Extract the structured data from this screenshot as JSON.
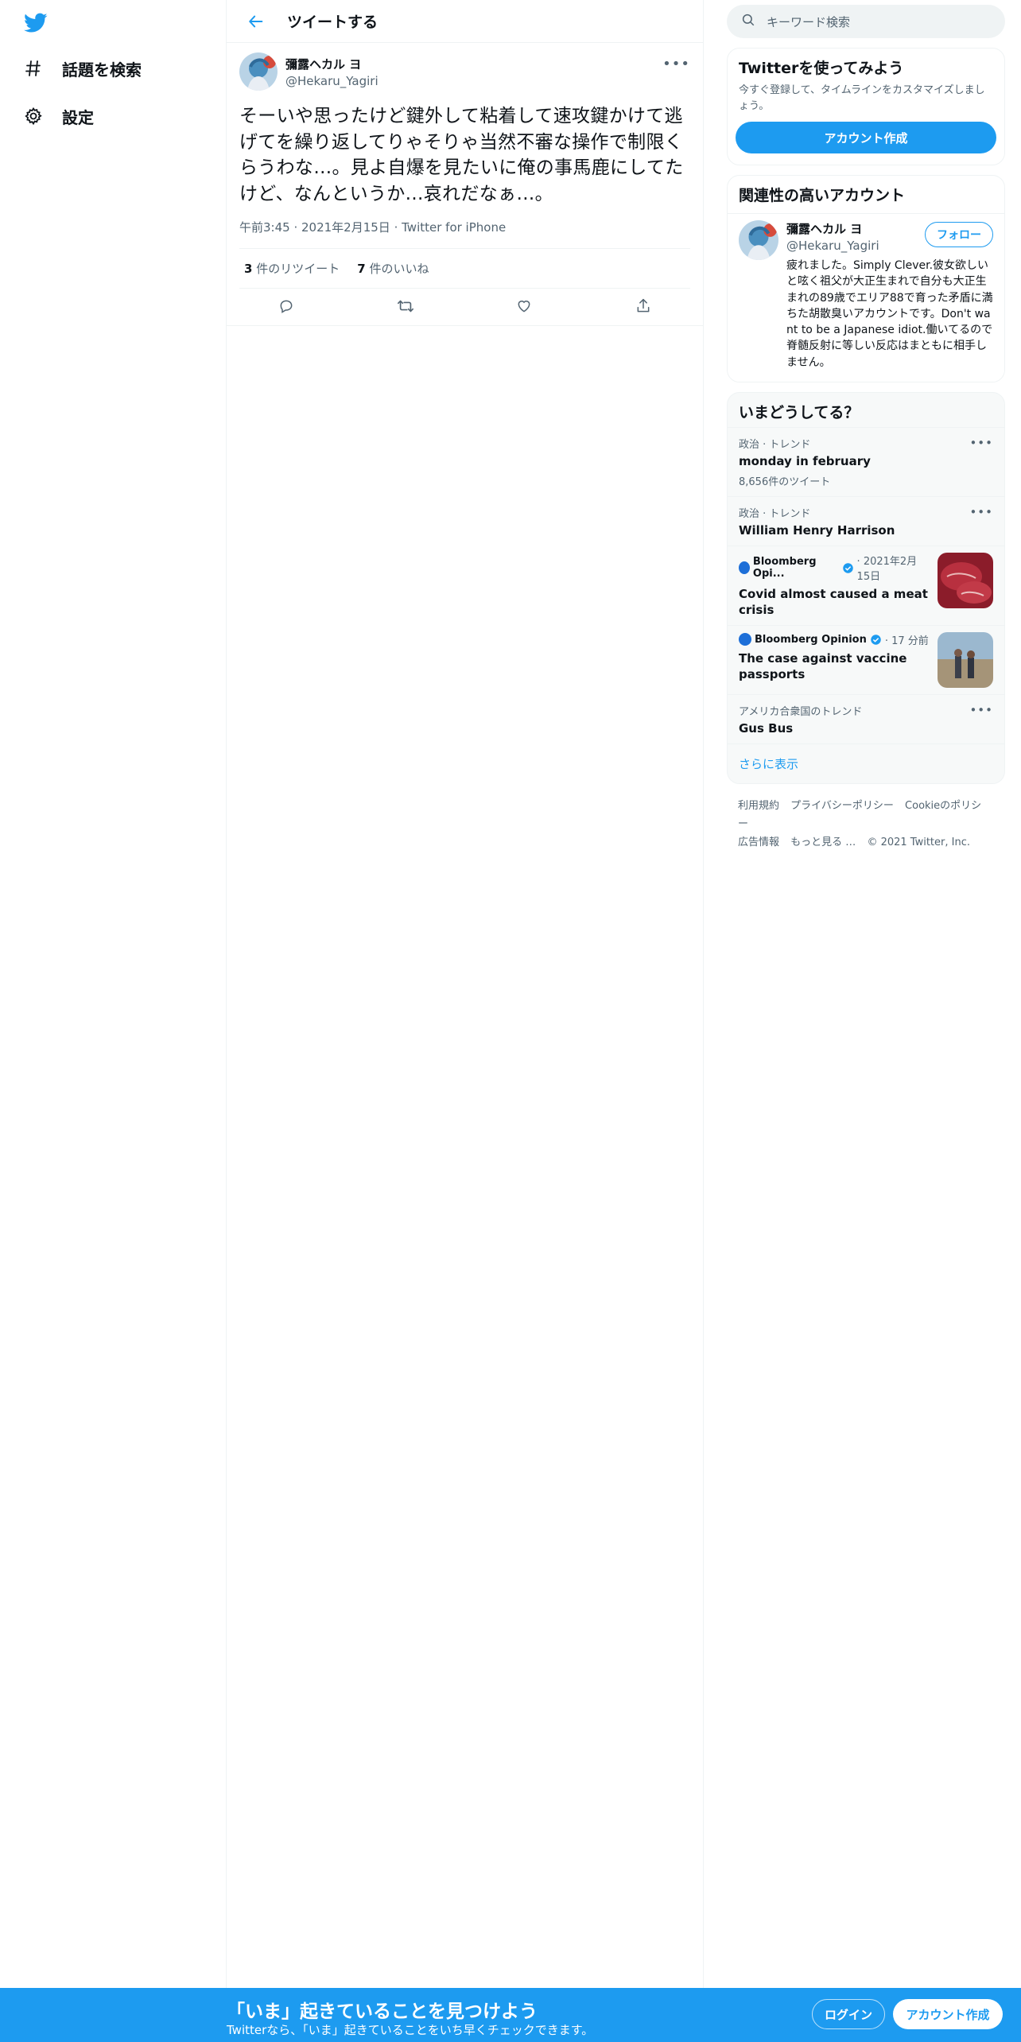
{
  "nav": {
    "items": [
      {
        "label": "話題を検索",
        "icon": "hashtag-icon"
      },
      {
        "label": "設定",
        "icon": "gear-icon"
      }
    ]
  },
  "header": {
    "title": "ツイートする"
  },
  "tweet": {
    "author_name": "彌露ヘカル ヨ",
    "author_handle": "@Hekaru_Yagiri",
    "text": "そーいや思ったけど鍵外して粘着して速攻鍵かけて逃げてを繰り返してりゃそりゃ当然不審な操作で制限くらうわな…。見よ自爆を見たいに俺の事馬鹿にしてたけど、なんというか…哀れだなぁ…。",
    "time": "午前3:45",
    "date": "2021年2月15日",
    "source": "Twitter for iPhone",
    "retweets_count": "3",
    "retweets_label": "件のリツイート",
    "likes_count": "7",
    "likes_label": "件のいいね"
  },
  "search": {
    "placeholder": "キーワード検索"
  },
  "signup_card": {
    "title": "Twitterを使ってみよう",
    "description": "今すぐ登録して、タイムラインをカスタマイズしましょう。",
    "button": "アカウント作成"
  },
  "related": {
    "title": "関連性の高いアカウント",
    "name": "彌露ヘカル ヨ",
    "handle": "@Hekaru_Yagiri",
    "follow": "フォロー",
    "bio": "疲れました。Simply Clever.彼女欲しいと呟く祖父が大正生まれで自分も大正生まれの89歳でエリア88で育った矛盾に満ちた胡散臭いアカウントです。Don't want to be a Japanese idiot.働いてるので脊髄反射に等しい反応はまともに相手しません。"
  },
  "trends": {
    "title": "いまどうしてる？",
    "items": [
      {
        "context": "政治 · トレンド",
        "name": "monday in february",
        "count": "8,656件のツイート"
      },
      {
        "context": "政治 · トレンド",
        "name": "William Henry Harrison"
      }
    ],
    "news": [
      {
        "source": "Bloomberg Opi...",
        "time": "2021年2月15日",
        "title": "Covid almost caused a meat crisis"
      },
      {
        "source": "Bloomberg Opinion",
        "time": "17 分前",
        "title": "The case against vaccine passports"
      }
    ],
    "last": {
      "context": "アメリカ合衆国のトレンド",
      "name": "Gus Bus"
    },
    "show_more": "さらに表示"
  },
  "footer": {
    "links": [
      "利用規約",
      "プライバシーポリシー",
      "Cookieのポリシー",
      "広告情報",
      "もっと見る …"
    ],
    "copyright": "© 2021 Twitter, Inc."
  },
  "bottom_bar": {
    "title": "「いま」起きていることを見つけよう",
    "subtitle": "Twitterなら、「いま」起きていることをいち早くチェックできます。",
    "login": "ログイン",
    "signup": "アカウント作成"
  },
  "colors": {
    "accent": "#1d9bf0",
    "text": "#0f1419",
    "secondary": "#536471"
  }
}
